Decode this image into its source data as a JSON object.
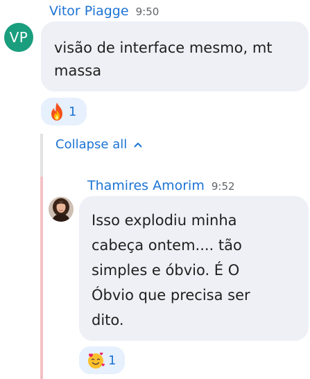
{
  "messages": [
    {
      "avatar_initials": "VP",
      "avatar_color": "#1a9e7e",
      "sender": "Vitor Piagge",
      "time": "9:50",
      "lines": [
        "visão de interface mesmo, mt",
        "massa"
      ],
      "reaction": {
        "icon": "fire-emoji-icon",
        "count": "1"
      }
    }
  ],
  "thread": {
    "collapse_label": "Collapse all",
    "replies": [
      {
        "sender": "Thamires Amorim",
        "time": "9:52",
        "lines": [
          "Isso explodiu minha",
          "cabeça ontem.... tão",
          "simples e óbvio. É O",
          "Óbvio que precisa ser",
          "dito."
        ],
        "reaction": {
          "icon": "smiling-face-with-hearts-emoji-icon",
          "count": "1"
        }
      }
    ]
  },
  "colors": {
    "link": "#1b73d4",
    "bubble": "#eef0f6",
    "reaction_bg": "#e7f0fd",
    "thread_line": "#e2e2e2",
    "thread_accent": "#f3c1c4"
  }
}
